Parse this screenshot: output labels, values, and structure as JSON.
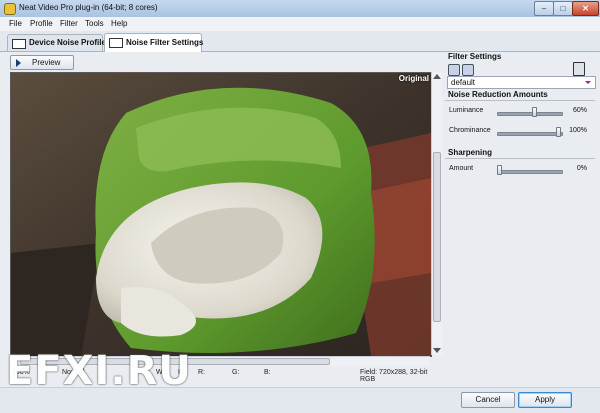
{
  "window": {
    "title": "Neat Video Pro plug-in (64-bit; 8 cores)",
    "controls": [
      "–",
      "□",
      "✕"
    ]
  },
  "menu": [
    "File",
    "Profile",
    "Filter",
    "Tools",
    "Help"
  ],
  "tabs": [
    {
      "label": "Device Noise Profile",
      "active": false,
      "icon": "camera-icon"
    },
    {
      "label": "Noise Filter Settings",
      "active": true,
      "icon": "settings-list-icon"
    }
  ],
  "preview": {
    "button_label": "Preview",
    "original_label": "Original"
  },
  "status": {
    "zoom": "100%",
    "mode": "Normal",
    "w_label": "W:",
    "h_label": "H:",
    "r_label": "R:",
    "g_label": "G:",
    "b_label": "B:",
    "field_info": "Field: 720x288, 32-bit RGB"
  },
  "watermark": "EFXI.RU",
  "filter_settings": {
    "header": "Filter Settings",
    "preset": "default",
    "accent_color": "#b01a8a"
  },
  "noise_reduction": {
    "header": "Noise Reduction Amounts",
    "sliders": [
      {
        "label": "Luminance",
        "value": "60%",
        "fraction": 0.6
      },
      {
        "label": "Chrominance",
        "value": "100%",
        "fraction": 1.0
      }
    ]
  },
  "sharpening": {
    "header": "Sharpening",
    "sliders": [
      {
        "label": "Amount",
        "value": "0%",
        "fraction": 0.0
      }
    ]
  },
  "footer": {
    "cancel_label": "Cancel",
    "apply_label": "Apply"
  }
}
